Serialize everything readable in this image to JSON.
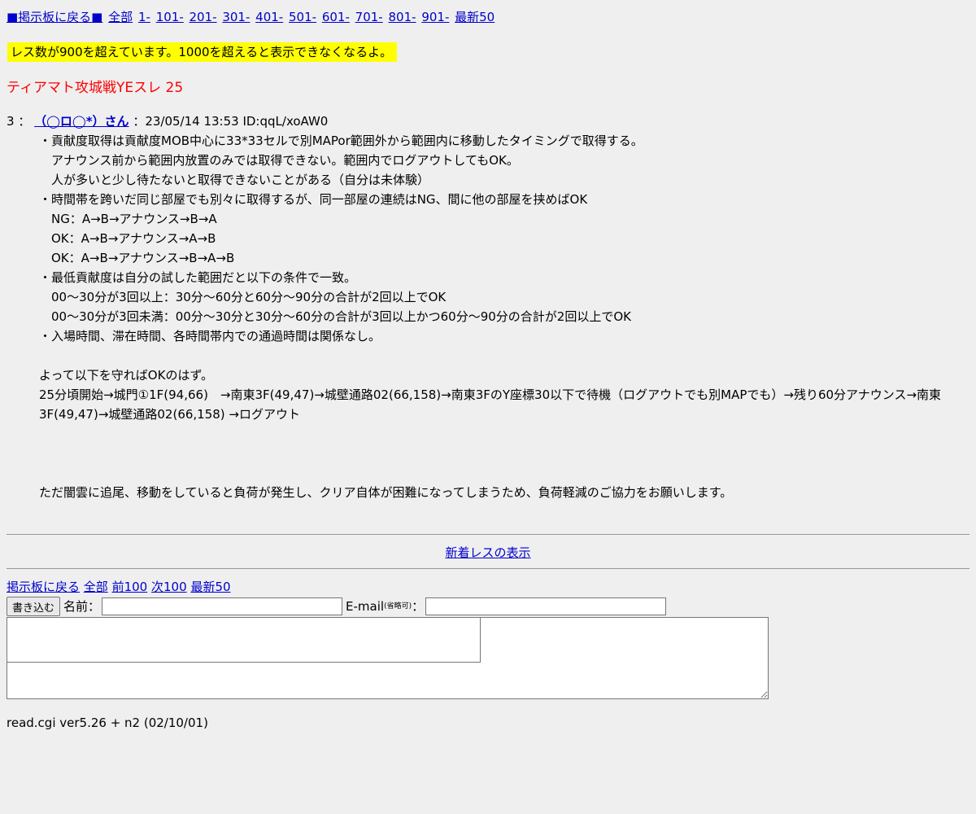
{
  "nav": {
    "back": "■掲示板に戻る■",
    "all": "全部",
    "ranges": [
      "1-",
      "101-",
      "201-",
      "301-",
      "401-",
      "501-",
      "601-",
      "701-",
      "801-",
      "901-"
    ],
    "latest": "最新50"
  },
  "warning": "レス数が900を超えています。1000を超えると表示できなくなるよ。",
  "thread_title": "ティアマト攻城戦YEスレ 25",
  "post": {
    "number": "3",
    "sep": "：",
    "name": "（◯ロ◯*）さん",
    "meta": "：23/05/14 13:53 ID:qqL/xoAW0",
    "lines": [
      "・貢献度取得は貢献度MOB中心に33*33セルで別MAPor範囲外から範囲内に移動したタイミングで取得する。",
      "　アナウンス前から範囲内放置のみでは取得できない。範囲内でログアウトしてもOK。",
      "　人が多いと少し待たないと取得できないことがある（自分は未体験）",
      "・時間帯を跨いだ同じ部屋でも別々に取得するが、同一部屋の連続はNG、間に他の部屋を挟めばOK",
      "　NG：A→B→アナウンス→B→A",
      "　OK：A→B→アナウンス→A→B",
      "　OK：A→B→アナウンス→B→A→B",
      "・最低貢献度は自分の試した範囲だと以下の条件で一致。",
      "　00〜30分が3回以上：30分〜60分と60分〜90分の合計が2回以上でOK",
      "　00〜30分が3回未満：00分〜30分と30分〜60分の合計が3回以上かつ60分〜90分の合計が2回以上でOK",
      "・入場時間、滞在時間、各時間帯内での通過時間は関係なし。",
      "",
      "よって以下を守ればOKのはず。",
      "25分頃開始→城門①1F(94,66)　→南東3F(49,47)→城壁通路02(66,158)→南東3FのY座標30以下で待機（ログアウトでも別MAPでも）→残り60分アナウンス→南東3F(49,47)→城壁通路02(66,158) →ログアウト",
      "",
      "",
      "",
      "ただ闇雲に追尾、移動をしていると負荷が発生し、クリア自体が困難になってしまうため、負荷軽減のご協力をお願いします。"
    ]
  },
  "new_responses_link": "新着レスの表示",
  "bottom_nav": {
    "back": "掲示板に戻る",
    "all": "全部",
    "prev": "前100",
    "next": "次100",
    "latest": "最新50"
  },
  "form": {
    "submit": "書き込む",
    "name_label": "名前：",
    "email_label": "E-mail",
    "email_note": "(省略可)",
    "email_colon": "：",
    "name_value": "",
    "email_value": ""
  },
  "footer": "read.cgi ver5.26 + n2 (02/10/01)",
  "colors": {
    "link": "#0000cc",
    "title": "#ff0000",
    "warning_bg": "#ffff00",
    "background": "#efefef"
  }
}
